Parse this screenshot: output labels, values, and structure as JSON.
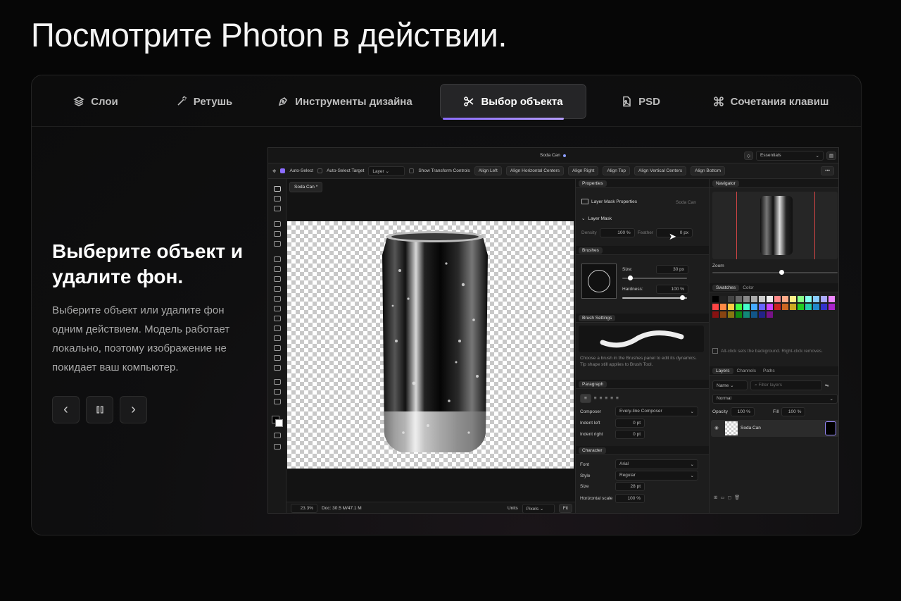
{
  "page": {
    "title": "Посмотрите Photon в действии."
  },
  "tabs": [
    {
      "label": "Слои",
      "icon": "layers-icon"
    },
    {
      "label": "Ретушь",
      "icon": "magic-wand-icon"
    },
    {
      "label": "Инструменты дизайна",
      "icon": "pen-tool-icon"
    },
    {
      "label": "Выбор объекта",
      "icon": "scissors-icon",
      "active": true
    },
    {
      "label": "PSD",
      "icon": "file-image-icon"
    },
    {
      "label": "Сочетания клавиш",
      "icon": "command-icon"
    }
  ],
  "feature": {
    "title": "Выберите объект и удалите фон.",
    "description": "Выберите объект или удалите фон одним действием. Модель работает локально, поэтому изображение не покидает ваш компьютер."
  },
  "controls": {
    "prev": "‹",
    "pause": "⏸",
    "next": "›"
  },
  "colors": {
    "accent": "#8b6cff",
    "background": "#060606"
  },
  "app": {
    "window_title": "Soda Can",
    "workspace": "Essentials",
    "options": {
      "auto_select": "Auto-Select",
      "auto_select_target": "Auto-Select Target",
      "target_value": "Layer",
      "show_transform": "Show Transform Controls",
      "align_left": "Align Left",
      "align_hcenters": "Align Horizontal Centers",
      "align_right": "Align Right",
      "align_top": "Align Top",
      "align_vcenters": "Align Vertical Centers",
      "align_bottom": "Align Bottom"
    },
    "doc_tab": "Soda Can *",
    "status": {
      "zoom": "23.3%",
      "doc": "Doc: 30.5 M/47.1 M",
      "units_label": "Units",
      "units_value": "Pixels",
      "fit": "Fit"
    },
    "properties": {
      "header": "Properties",
      "title": "Layer Mask Properties",
      "layer": "Soda Can",
      "section": "Layer Mask",
      "density_label": "Density",
      "density_value": "100",
      "density_unit": "%",
      "feather_label": "Feather",
      "feather_value": "0",
      "feather_unit": "px"
    },
    "brushes": {
      "header": "Brushes",
      "size_label": "Size:",
      "size_value": "30",
      "size_unit": "px",
      "hardness_label": "Hardness:",
      "hardness_value": "100",
      "hardness_unit": "%"
    },
    "brush_settings": {
      "header": "Brush Settings",
      "note": "Choose a brush in the Brushes panel to edit its dynamics. Tip shape still applies to Brush Tool."
    },
    "paragraph": {
      "header": "Paragraph",
      "composer_label": "Composer",
      "composer_value": "Every-line Composer",
      "indent_left_label": "Indent left",
      "indent_left_value": "0",
      "indent_left_unit": "pt",
      "indent_right_label": "Indent right",
      "indent_right_value": "0",
      "indent_right_unit": "pt"
    },
    "character": {
      "header": "Character",
      "font_label": "Font",
      "font_value": "Arial",
      "style_label": "Style",
      "style_value": "Regular",
      "size_label": "Size",
      "size_value": "28",
      "size_unit": "pt",
      "hscale_label": "Horizontal scale",
      "hscale_value": "100",
      "hscale_unit": "%"
    },
    "navigator": {
      "header": "Navigator",
      "zoom_label": "Zoom",
      "zoom_level": 0.55
    },
    "swatches": {
      "tab1": "Swatches",
      "tab2": "Color",
      "hint": "Alt-click sets the background. Right-click removes."
    },
    "layers": {
      "tab1": "Layers",
      "tab2": "Channels",
      "tab3": "Paths",
      "filter_kind": "Name",
      "filter_placeholder": "Filter layers",
      "blend": "Normal",
      "opacity_label": "Opacity",
      "opacity_value": "100",
      "opacity_unit": "%",
      "fill_label": "Fill",
      "fill_value": "100",
      "fill_unit": "%",
      "layer_name": "Soda Can"
    }
  }
}
